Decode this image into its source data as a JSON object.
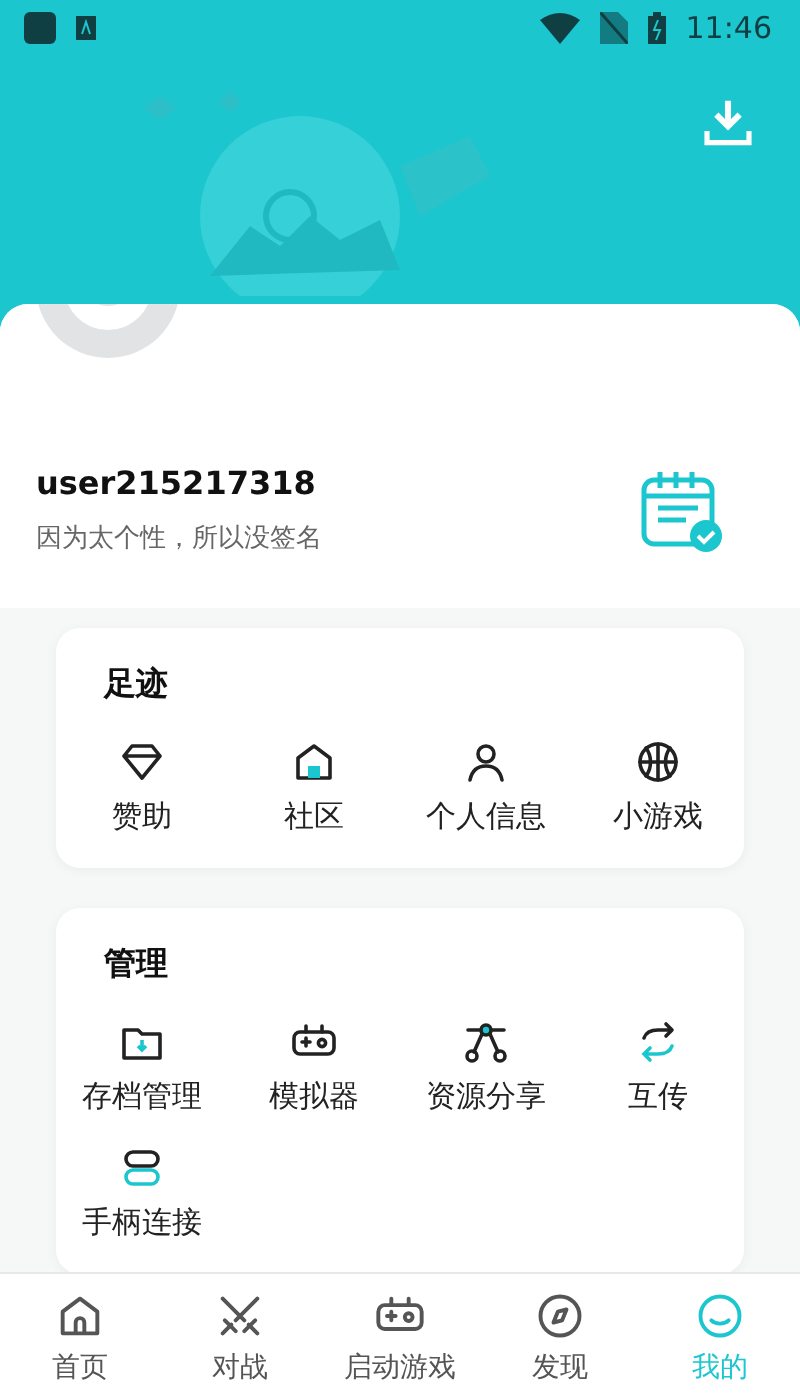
{
  "status_bar": {
    "time": "11:46"
  },
  "profile": {
    "username": "user215217318",
    "signature": "因为太个性，所以没签名"
  },
  "sections": [
    {
      "title": "足迹",
      "items": [
        {
          "label": "赞助",
          "kind": "diamond"
        },
        {
          "label": "社区",
          "kind": "house"
        },
        {
          "label": "个人信息",
          "kind": "person"
        },
        {
          "label": "小游戏",
          "kind": "ball"
        }
      ]
    },
    {
      "title": "管理",
      "items": [
        {
          "label": "存档管理",
          "kind": "folder"
        },
        {
          "label": "模拟器",
          "kind": "gamepad"
        },
        {
          "label": "资源分享",
          "kind": "share"
        },
        {
          "label": "互传",
          "kind": "sync"
        },
        {
          "label": "手柄连接",
          "kind": "link"
        }
      ]
    }
  ],
  "nav": [
    {
      "label": "首页",
      "kind": "home",
      "selected": false
    },
    {
      "label": "对战",
      "kind": "swords",
      "selected": false
    },
    {
      "label": "启动游戏",
      "kind": "gamepad",
      "selected": false
    },
    {
      "label": "发现",
      "kind": "compass",
      "selected": false
    },
    {
      "label": "我的",
      "kind": "face",
      "selected": true
    }
  ]
}
